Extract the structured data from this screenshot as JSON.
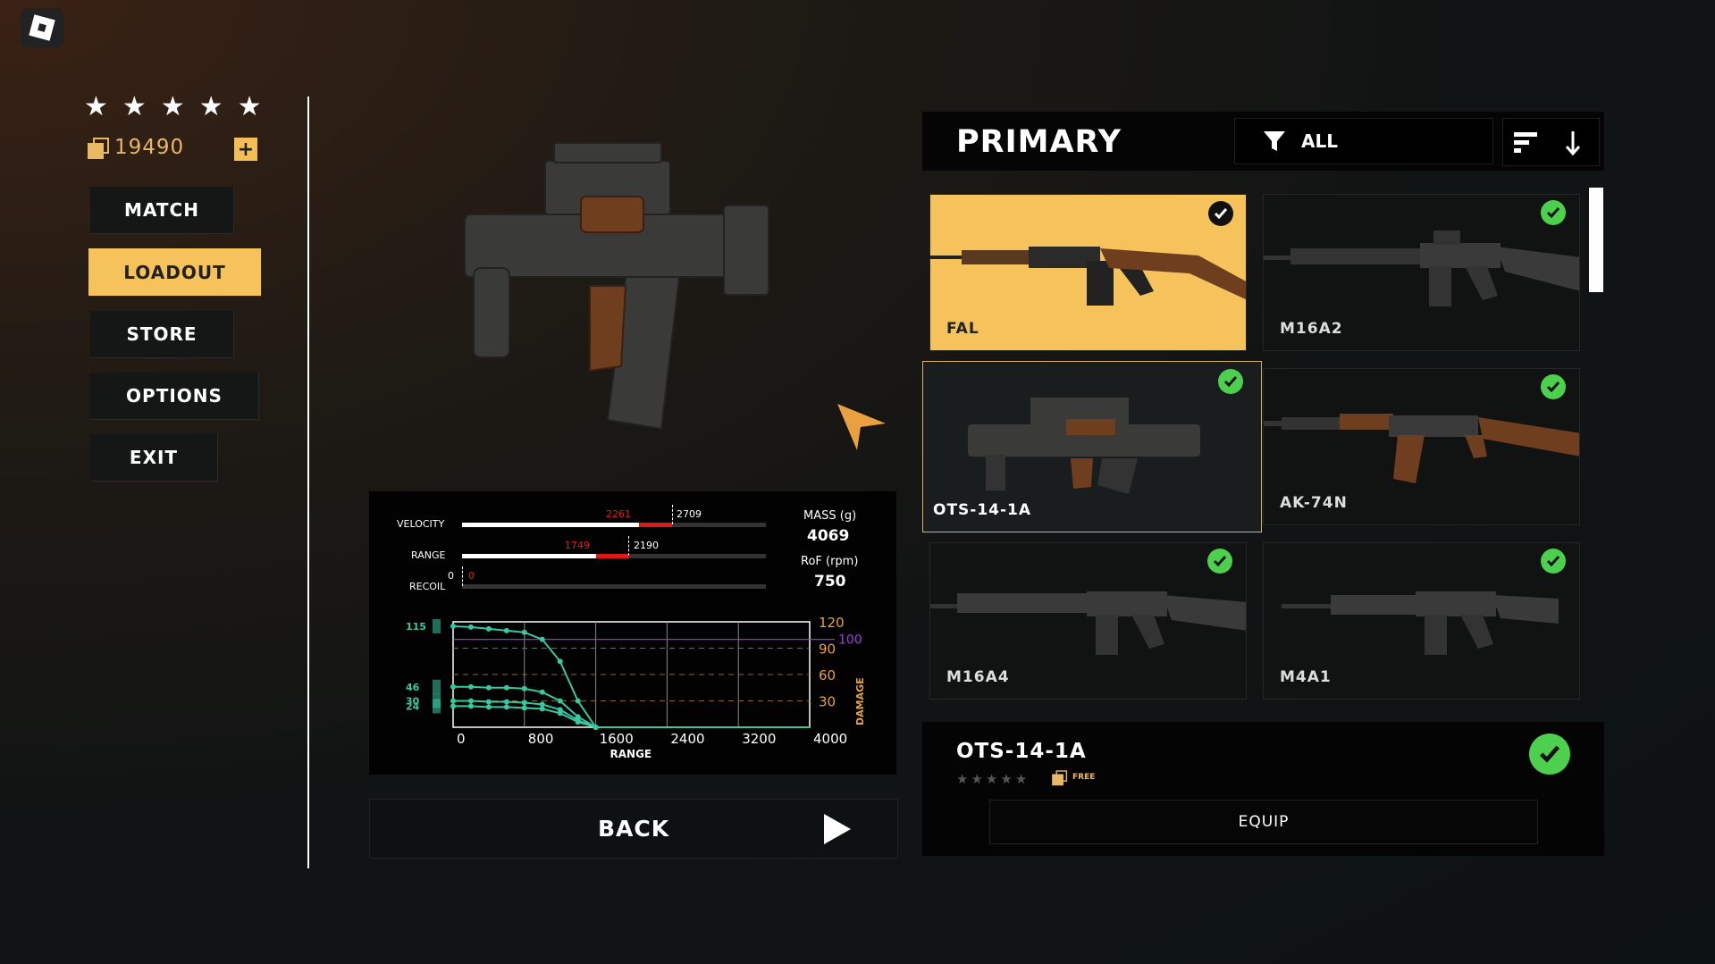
{
  "app": {
    "logo_icon": "roblox-logo-icon"
  },
  "profile": {
    "rating_stars": 5,
    "star_glyph": "★",
    "currency_amount": "19490",
    "add_currency_label": "+"
  },
  "menu": {
    "items": [
      {
        "label": "MATCH",
        "active": false
      },
      {
        "label": "LOADOUT",
        "active": true
      },
      {
        "label": "STORE",
        "active": false
      },
      {
        "label": "OPTIONS",
        "active": false
      },
      {
        "label": "EXIT",
        "active": false
      }
    ]
  },
  "stats": {
    "velocity_label": "VELOCITY",
    "velocity_current": "2261",
    "velocity_max": "2709",
    "range_label": "RANGE",
    "range_current": "1749",
    "range_max": "2190",
    "recoil_label": "RECOIL",
    "recoil_base": "0",
    "recoil_current": "0",
    "mass_label": "MASS (g)",
    "mass_value": "4069",
    "rof_label": "RoF (rpm)",
    "rof_value": "750"
  },
  "chart_data": {
    "type": "line",
    "xlabel": "RANGE",
    "ylabel": "DAMAGE",
    "x_ticks": [
      "0",
      "800",
      "1600",
      "2400",
      "3200",
      "4000"
    ],
    "y_ticks_right": [
      "120",
      "90",
      "60",
      "30"
    ],
    "reference_line_label": "100",
    "left_labels": [
      "115",
      "46",
      "30",
      "24"
    ],
    "xlim": [
      0,
      4000
    ],
    "ylim": [
      0,
      120
    ],
    "series": [
      {
        "x": [
          0,
          200,
          400,
          600,
          800,
          1000,
          1200,
          1400,
          1600,
          4000
        ],
        "values": [
          115,
          114,
          112,
          110,
          108,
          100,
          75,
          30,
          0,
          0
        ]
      },
      {
        "x": [
          0,
          200,
          400,
          600,
          800,
          1000,
          1200,
          1400,
          1600,
          4000
        ],
        "values": [
          46,
          46,
          45,
          45,
          44,
          40,
          30,
          12,
          0,
          0
        ]
      },
      {
        "x": [
          0,
          200,
          400,
          600,
          800,
          1000,
          1200,
          1400,
          1600,
          4000
        ],
        "values": [
          30,
          30,
          29,
          29,
          28,
          26,
          20,
          8,
          0,
          0
        ]
      },
      {
        "x": [
          0,
          200,
          400,
          600,
          800,
          1000,
          1200,
          1400,
          1600,
          4000
        ],
        "values": [
          24,
          24,
          23,
          23,
          22,
          21,
          16,
          6,
          0,
          0
        ]
      }
    ],
    "colors": {
      "lines": "#36c9a0",
      "reference": "#a040e0",
      "axis_right": "#e8a040"
    }
  },
  "back": {
    "label": "BACK"
  },
  "primary": {
    "title": "PRIMARY",
    "filter_label": "ALL",
    "filter_icon": "filter-icon",
    "sort_icon": "sort-icon"
  },
  "weapons": [
    {
      "name": "FAL",
      "state": "selected",
      "owned": true
    },
    {
      "name": "M16A2",
      "state": "normal",
      "owned": true
    },
    {
      "name": "OTS-14-1A",
      "state": "current",
      "owned": true
    },
    {
      "name": "AK-74N",
      "state": "normal",
      "owned": true
    },
    {
      "name": "M16A4",
      "state": "normal",
      "owned": true
    },
    {
      "name": "M4A1",
      "state": "normal",
      "owned": true
    }
  ],
  "detail": {
    "name": "OTS-14-1A",
    "price": "FREE",
    "equip_label": "EQUIP"
  }
}
